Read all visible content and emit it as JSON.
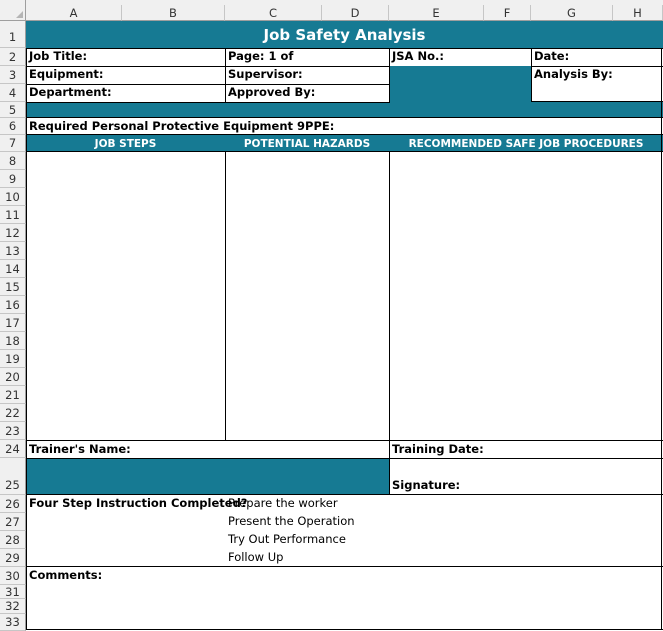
{
  "columns": [
    "A",
    "B",
    "C",
    "D",
    "E",
    "F",
    "G",
    "H"
  ],
  "rows": [
    "1",
    "2",
    "3",
    "4",
    "5",
    "6",
    "7",
    "8",
    "9",
    "10",
    "11",
    "12",
    "13",
    "14",
    "15",
    "16",
    "17",
    "18",
    "19",
    "20",
    "21",
    "22",
    "23",
    "24",
    "25",
    "26",
    "27",
    "28",
    "29",
    "30",
    "31",
    "32",
    "33"
  ],
  "form": {
    "title": "Job Safety Analysis",
    "job_title": "Job Title:",
    "page": "Page: 1 of",
    "jsa_no": "JSA No.:",
    "date": "Date:",
    "equipment": "Equipment:",
    "supervisor": "Supervisor:",
    "analysis_by": "Analysis By:",
    "department": "Department:",
    "approved_by": "Approved By:",
    "ppe": "Required Personal Protective Equipment 9PPE:",
    "job_steps": "JOB STEPS",
    "potential_hazards": "POTENTIAL HAZARDS",
    "recommended": "RECOMMENDED SAFE JOB PROCEDURES",
    "trainer_name": "Trainer's Name:",
    "training_date": "Training Date:",
    "signature": "Signature:",
    "four_step": "Four Step Instruction Completed?",
    "steps": [
      "Prepare the worker",
      "Present the Operation",
      "Try Out Performance",
      "Follow Up"
    ],
    "comments": "Comments:"
  },
  "colors": {
    "accent": "#167a93",
    "header_bg": "#f0f0f0"
  }
}
